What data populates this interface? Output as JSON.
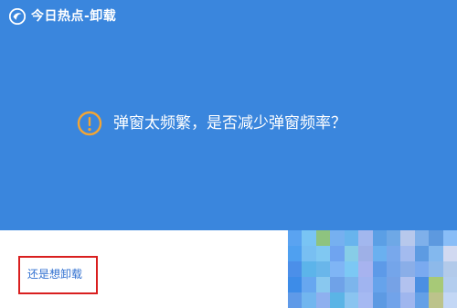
{
  "window": {
    "title": "今日热点-卸载"
  },
  "message": {
    "text": "弹窗太频繁，是否减少弹窗频率？",
    "icon": "warning-icon"
  },
  "footer": {
    "link_label": "还是想卸载"
  },
  "colors": {
    "header_bg": "#3a86dd",
    "text_light": "#ffffff",
    "warning_orange": "#f3a533",
    "link_blue": "#2f6fd0",
    "highlight_red": "#d91f1f"
  },
  "mosaic_colors": [
    "#5aa3f1",
    "#79c4f4",
    "#8ec37f",
    "#76b0f0",
    "#68b4ed",
    "#a2b7ee",
    "#5b9fe5",
    "#6ea8e6",
    "#b7c8ec",
    "#7fb0ea",
    "#5d99df",
    "#89bdf7",
    "#4fa0f0",
    "#78bff2",
    "#80c8f2",
    "#6fa4f0",
    "#87cde7",
    "#9eb0e7",
    "#6ab0f0",
    "#78a8ec",
    "#a3bbef",
    "#5d9be2",
    "#83b8ee",
    "#d1d9f1",
    "#4b8fe9",
    "#5cb4ea",
    "#69b6ea",
    "#7fb5f5",
    "#7cc8f4",
    "#a7b3ef",
    "#5d9ae8",
    "#74a5ea",
    "#8aaee8",
    "#7aaaf0",
    "#8db9ea",
    "#b2caea",
    "#3d8ce8",
    "#67a7f0",
    "#89c8ef",
    "#6fa2e8",
    "#7cb5ec",
    "#a0b4f0",
    "#66a3eb",
    "#76a2e6",
    "#b2c2ef",
    "#4b8fe2",
    "#a7c977",
    "#b3cdee",
    "#5f9ae8",
    "#72b6ef",
    "#8eb0ef",
    "#5bb4e6",
    "#8ac4f0",
    "#a5b9f2",
    "#5d9ae3",
    "#71a3ea",
    "#9fb6ee",
    "#64a0e7",
    "#bcc38b",
    "#c3d7f5"
  ]
}
